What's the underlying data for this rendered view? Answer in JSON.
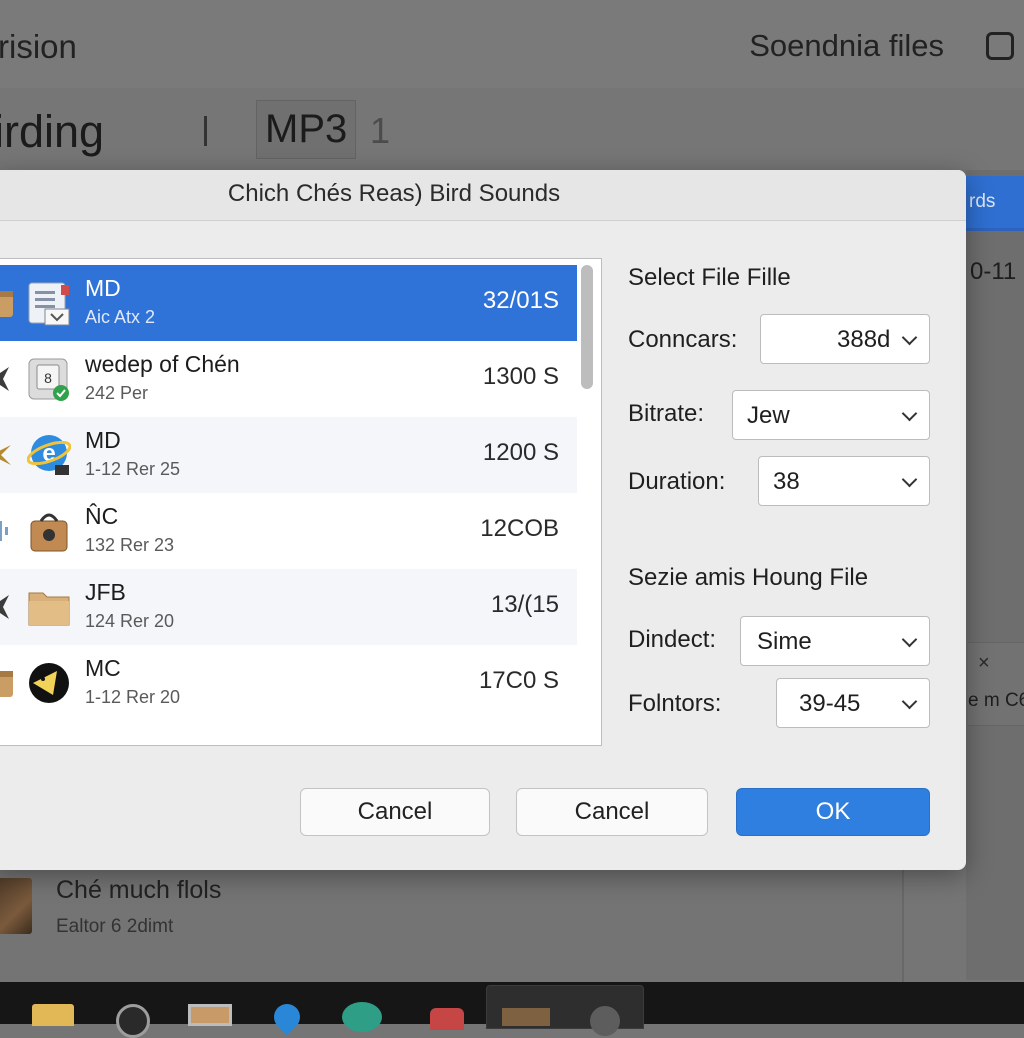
{
  "background": {
    "title_partial": "rision",
    "share_label": "Soendnia files",
    "heading_partial": "irding",
    "format_tab": "MP3",
    "format_count": "1",
    "right_tab_partial": "rds",
    "right_number_partial": "0-11",
    "right_close": "×",
    "right_small_partial": "e m C6",
    "bottom_item": {
      "title": "Ché much flols",
      "subtitle": "Ealtor 6 2dimt"
    }
  },
  "dialog": {
    "title": "Chich Chés Reas) Bird Sounds",
    "files": [
      {
        "name": "MD",
        "meta": "Aic Atx 2",
        "size": "32/01S",
        "selected": true,
        "thumb": "document-icon"
      },
      {
        "name": "wedep of Chén",
        "meta": "242 Per",
        "size": "1300 S",
        "selected": false,
        "thumb": "disk-icon"
      },
      {
        "name": "MD",
        "meta": "1-12 Rer 25",
        "size": "1200 S",
        "selected": false,
        "thumb": "browser-icon"
      },
      {
        "name": "N̂C",
        "meta": "132 Rer 23",
        "size": "12COB",
        "selected": false,
        "thumb": "bag-icon"
      },
      {
        "name": "JFB",
        "meta": "124 Rer 20",
        "size": "13/(15",
        "selected": false,
        "thumb": "folder-icon"
      },
      {
        "name": "MC",
        "meta": "1-12 Rer 20",
        "size": "17C0 S",
        "selected": false,
        "thumb": "bird-icon"
      }
    ],
    "select_section_title": "Select File Fille",
    "fields": {
      "conncars": {
        "label": "Conncars:",
        "value": "388d"
      },
      "bitrate": {
        "label": "Bitrate:",
        "value": "Jew"
      },
      "duration": {
        "label": "Duration:",
        "value": "38"
      }
    },
    "size_section_title": "Sezie amis Houng File",
    "fields2": {
      "dindect": {
        "label": "Dindect:",
        "value": "Sime"
      },
      "folntors": {
        "label": "Folntors:",
        "value": "39-45"
      }
    },
    "buttons": {
      "cancel1": "Cancel",
      "cancel2": "Cancel",
      "ok": "OK"
    },
    "colors": {
      "selection": "#2f73d8",
      "primary": "#2f7fe0"
    }
  }
}
